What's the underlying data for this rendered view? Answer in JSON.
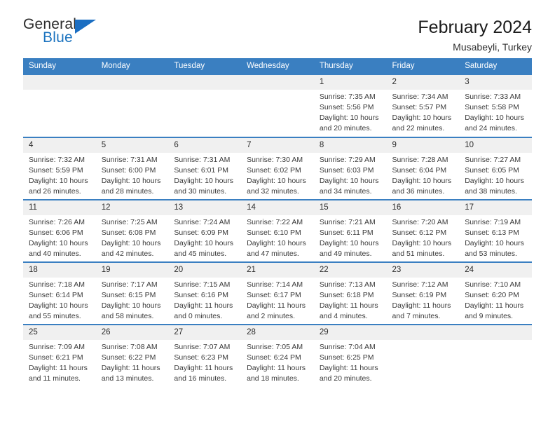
{
  "brand": {
    "name_top": "General",
    "name_bottom": "Blue",
    "accent_color": "#1b6ec2"
  },
  "header": {
    "title": "February 2024",
    "subtitle": "Musabeyli, Turkey"
  },
  "theme": {
    "header_blue": "#3a7fc1",
    "daynum_band": "#f0f0f0",
    "text": "#3a3a3a"
  },
  "calendar": {
    "weekday_headers": [
      "Sunday",
      "Monday",
      "Tuesday",
      "Wednesday",
      "Thursday",
      "Friday",
      "Saturday"
    ],
    "weeks": [
      [
        {
          "day": "",
          "lines": []
        },
        {
          "day": "",
          "lines": []
        },
        {
          "day": "",
          "lines": []
        },
        {
          "day": "",
          "lines": []
        },
        {
          "day": "1",
          "lines": [
            "Sunrise: 7:35 AM",
            "Sunset: 5:56 PM",
            "Daylight: 10 hours",
            "and 20 minutes."
          ]
        },
        {
          "day": "2",
          "lines": [
            "Sunrise: 7:34 AM",
            "Sunset: 5:57 PM",
            "Daylight: 10 hours",
            "and 22 minutes."
          ]
        },
        {
          "day": "3",
          "lines": [
            "Sunrise: 7:33 AM",
            "Sunset: 5:58 PM",
            "Daylight: 10 hours",
            "and 24 minutes."
          ]
        }
      ],
      [
        {
          "day": "4",
          "lines": [
            "Sunrise: 7:32 AM",
            "Sunset: 5:59 PM",
            "Daylight: 10 hours",
            "and 26 minutes."
          ]
        },
        {
          "day": "5",
          "lines": [
            "Sunrise: 7:31 AM",
            "Sunset: 6:00 PM",
            "Daylight: 10 hours",
            "and 28 minutes."
          ]
        },
        {
          "day": "6",
          "lines": [
            "Sunrise: 7:31 AM",
            "Sunset: 6:01 PM",
            "Daylight: 10 hours",
            "and 30 minutes."
          ]
        },
        {
          "day": "7",
          "lines": [
            "Sunrise: 7:30 AM",
            "Sunset: 6:02 PM",
            "Daylight: 10 hours",
            "and 32 minutes."
          ]
        },
        {
          "day": "8",
          "lines": [
            "Sunrise: 7:29 AM",
            "Sunset: 6:03 PM",
            "Daylight: 10 hours",
            "and 34 minutes."
          ]
        },
        {
          "day": "9",
          "lines": [
            "Sunrise: 7:28 AM",
            "Sunset: 6:04 PM",
            "Daylight: 10 hours",
            "and 36 minutes."
          ]
        },
        {
          "day": "10",
          "lines": [
            "Sunrise: 7:27 AM",
            "Sunset: 6:05 PM",
            "Daylight: 10 hours",
            "and 38 minutes."
          ]
        }
      ],
      [
        {
          "day": "11",
          "lines": [
            "Sunrise: 7:26 AM",
            "Sunset: 6:06 PM",
            "Daylight: 10 hours",
            "and 40 minutes."
          ]
        },
        {
          "day": "12",
          "lines": [
            "Sunrise: 7:25 AM",
            "Sunset: 6:08 PM",
            "Daylight: 10 hours",
            "and 42 minutes."
          ]
        },
        {
          "day": "13",
          "lines": [
            "Sunrise: 7:24 AM",
            "Sunset: 6:09 PM",
            "Daylight: 10 hours",
            "and 45 minutes."
          ]
        },
        {
          "day": "14",
          "lines": [
            "Sunrise: 7:22 AM",
            "Sunset: 6:10 PM",
            "Daylight: 10 hours",
            "and 47 minutes."
          ]
        },
        {
          "day": "15",
          "lines": [
            "Sunrise: 7:21 AM",
            "Sunset: 6:11 PM",
            "Daylight: 10 hours",
            "and 49 minutes."
          ]
        },
        {
          "day": "16",
          "lines": [
            "Sunrise: 7:20 AM",
            "Sunset: 6:12 PM",
            "Daylight: 10 hours",
            "and 51 minutes."
          ]
        },
        {
          "day": "17",
          "lines": [
            "Sunrise: 7:19 AM",
            "Sunset: 6:13 PM",
            "Daylight: 10 hours",
            "and 53 minutes."
          ]
        }
      ],
      [
        {
          "day": "18",
          "lines": [
            "Sunrise: 7:18 AM",
            "Sunset: 6:14 PM",
            "Daylight: 10 hours",
            "and 55 minutes."
          ]
        },
        {
          "day": "19",
          "lines": [
            "Sunrise: 7:17 AM",
            "Sunset: 6:15 PM",
            "Daylight: 10 hours",
            "and 58 minutes."
          ]
        },
        {
          "day": "20",
          "lines": [
            "Sunrise: 7:15 AM",
            "Sunset: 6:16 PM",
            "Daylight: 11 hours",
            "and 0 minutes."
          ]
        },
        {
          "day": "21",
          "lines": [
            "Sunrise: 7:14 AM",
            "Sunset: 6:17 PM",
            "Daylight: 11 hours",
            "and 2 minutes."
          ]
        },
        {
          "day": "22",
          "lines": [
            "Sunrise: 7:13 AM",
            "Sunset: 6:18 PM",
            "Daylight: 11 hours",
            "and 4 minutes."
          ]
        },
        {
          "day": "23",
          "lines": [
            "Sunrise: 7:12 AM",
            "Sunset: 6:19 PM",
            "Daylight: 11 hours",
            "and 7 minutes."
          ]
        },
        {
          "day": "24",
          "lines": [
            "Sunrise: 7:10 AM",
            "Sunset: 6:20 PM",
            "Daylight: 11 hours",
            "and 9 minutes."
          ]
        }
      ],
      [
        {
          "day": "25",
          "lines": [
            "Sunrise: 7:09 AM",
            "Sunset: 6:21 PM",
            "Daylight: 11 hours",
            "and 11 minutes."
          ]
        },
        {
          "day": "26",
          "lines": [
            "Sunrise: 7:08 AM",
            "Sunset: 6:22 PM",
            "Daylight: 11 hours",
            "and 13 minutes."
          ]
        },
        {
          "day": "27",
          "lines": [
            "Sunrise: 7:07 AM",
            "Sunset: 6:23 PM",
            "Daylight: 11 hours",
            "and 16 minutes."
          ]
        },
        {
          "day": "28",
          "lines": [
            "Sunrise: 7:05 AM",
            "Sunset: 6:24 PM",
            "Daylight: 11 hours",
            "and 18 minutes."
          ]
        },
        {
          "day": "29",
          "lines": [
            "Sunrise: 7:04 AM",
            "Sunset: 6:25 PM",
            "Daylight: 11 hours",
            "and 20 minutes."
          ]
        },
        {
          "day": "",
          "lines": []
        },
        {
          "day": "",
          "lines": []
        }
      ]
    ]
  }
}
